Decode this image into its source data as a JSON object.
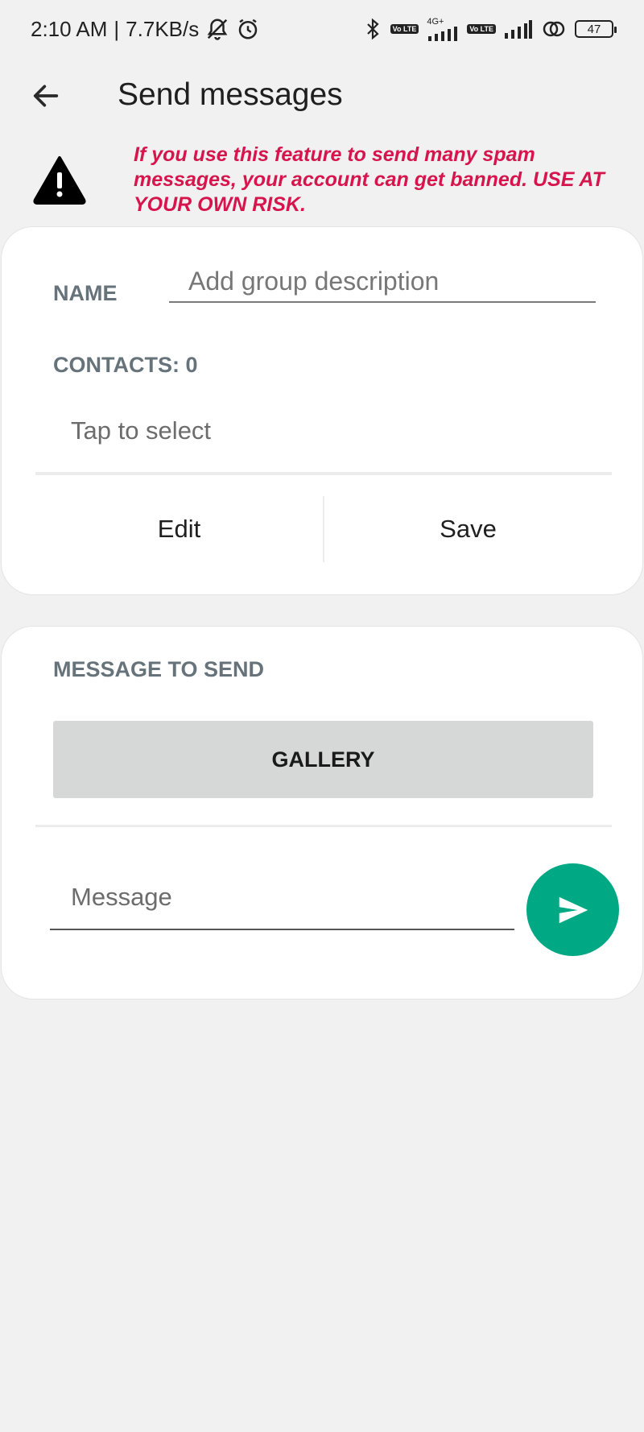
{
  "status_bar": {
    "time": "2:10 AM",
    "separator": "|",
    "speed": "7.7KB/s",
    "network1": "4G+",
    "volte1": "Vo LTE",
    "volte2": "Vo LTE",
    "battery": "47",
    "icons": [
      "silent-icon",
      "alarm-icon",
      "bluetooth-icon",
      "signal-icon",
      "signal-icon",
      "hotspot-icon",
      "battery-icon"
    ]
  },
  "toolbar": {
    "title": "Send messages",
    "back_icon": "arrow-left-icon"
  },
  "warning": {
    "icon": "warning-icon",
    "text": "If you use this feature to send many spam messages, your account can get banned. USE AT YOUR OWN RISK.",
    "color": "#d6154d"
  },
  "group_card": {
    "name_label": "NAME",
    "name_placeholder": "Add group description",
    "name_value": "",
    "contacts_label": "CONTACTS: 0",
    "tap_to_select": "Tap to select",
    "edit_label": "Edit",
    "save_label": "Save"
  },
  "message_card": {
    "section_label": "MESSAGE TO SEND",
    "gallery_label": "GALLERY",
    "message_placeholder": "Message",
    "message_value": "",
    "send_icon": "send-icon",
    "send_color": "#00a884"
  }
}
